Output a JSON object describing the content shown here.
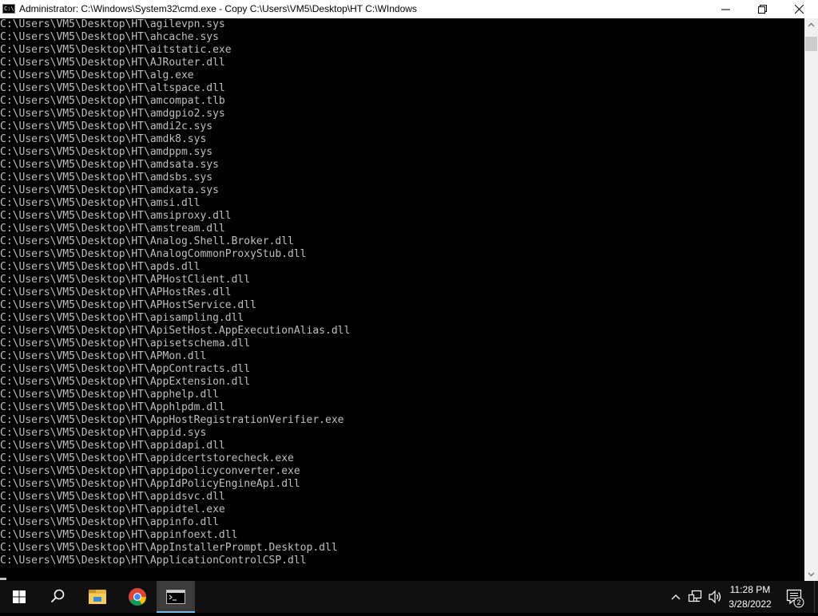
{
  "window": {
    "icon_text": "C:\\",
    "title": "Administrator: C:\\Windows\\System32\\cmd.exe - Copy  C:\\Users\\VM5\\Desktop\\HT C:\\WIndows"
  },
  "console": {
    "lines": [
      "C:\\Users\\VM5\\Desktop\\HT\\agilevpn.sys",
      "C:\\Users\\VM5\\Desktop\\HT\\ahcache.sys",
      "C:\\Users\\VM5\\Desktop\\HT\\aitstatic.exe",
      "C:\\Users\\VM5\\Desktop\\HT\\AJRouter.dll",
      "C:\\Users\\VM5\\Desktop\\HT\\alg.exe",
      "C:\\Users\\VM5\\Desktop\\HT\\altspace.dll",
      "C:\\Users\\VM5\\Desktop\\HT\\amcompat.tlb",
      "C:\\Users\\VM5\\Desktop\\HT\\amdgpio2.sys",
      "C:\\Users\\VM5\\Desktop\\HT\\amdi2c.sys",
      "C:\\Users\\VM5\\Desktop\\HT\\amdk8.sys",
      "C:\\Users\\VM5\\Desktop\\HT\\amdppm.sys",
      "C:\\Users\\VM5\\Desktop\\HT\\amdsata.sys",
      "C:\\Users\\VM5\\Desktop\\HT\\amdsbs.sys",
      "C:\\Users\\VM5\\Desktop\\HT\\amdxata.sys",
      "C:\\Users\\VM5\\Desktop\\HT\\amsi.dll",
      "C:\\Users\\VM5\\Desktop\\HT\\amsiproxy.dll",
      "C:\\Users\\VM5\\Desktop\\HT\\amstream.dll",
      "C:\\Users\\VM5\\Desktop\\HT\\Analog.Shell.Broker.dll",
      "C:\\Users\\VM5\\Desktop\\HT\\AnalogCommonProxyStub.dll",
      "C:\\Users\\VM5\\Desktop\\HT\\apds.dll",
      "C:\\Users\\VM5\\Desktop\\HT\\APHostClient.dll",
      "C:\\Users\\VM5\\Desktop\\HT\\APHostRes.dll",
      "C:\\Users\\VM5\\Desktop\\HT\\APHostService.dll",
      "C:\\Users\\VM5\\Desktop\\HT\\apisampling.dll",
      "C:\\Users\\VM5\\Desktop\\HT\\ApiSetHost.AppExecutionAlias.dll",
      "C:\\Users\\VM5\\Desktop\\HT\\apisetschema.dll",
      "C:\\Users\\VM5\\Desktop\\HT\\APMon.dll",
      "C:\\Users\\VM5\\Desktop\\HT\\AppContracts.dll",
      "C:\\Users\\VM5\\Desktop\\HT\\AppExtension.dll",
      "C:\\Users\\VM5\\Desktop\\HT\\apphelp.dll",
      "C:\\Users\\VM5\\Desktop\\HT\\Apphlpdm.dll",
      "C:\\Users\\VM5\\Desktop\\HT\\AppHostRegistrationVerifier.exe",
      "C:\\Users\\VM5\\Desktop\\HT\\appid.sys",
      "C:\\Users\\VM5\\Desktop\\HT\\appidapi.dll",
      "C:\\Users\\VM5\\Desktop\\HT\\appidcertstorecheck.exe",
      "C:\\Users\\VM5\\Desktop\\HT\\appidpolicyconverter.exe",
      "C:\\Users\\VM5\\Desktop\\HT\\AppIdPolicyEngineApi.dll",
      "C:\\Users\\VM5\\Desktop\\HT\\appidsvc.dll",
      "C:\\Users\\VM5\\Desktop\\HT\\appidtel.exe",
      "C:\\Users\\VM5\\Desktop\\HT\\appinfo.dll",
      "C:\\Users\\VM5\\Desktop\\HT\\appinfoext.dll",
      "C:\\Users\\VM5\\Desktop\\HT\\AppInstallerPrompt.Desktop.dll",
      "C:\\Users\\VM5\\Desktop\\HT\\ApplicationControlCSP.dll"
    ]
  },
  "taskbar": {
    "apps": [
      "windows-start-icon",
      "search-icon",
      "file-explorer-icon",
      "chrome-icon",
      "command-prompt-icon"
    ],
    "clock": {
      "time": "11:28 PM",
      "date": "3/28/2022"
    },
    "notifications": {
      "count": "2"
    }
  },
  "colors": {
    "console_bg": "#000000",
    "console_text": "#c0c0c0",
    "titlebar_bg": "#ffffff",
    "taskbar_bg": "#101010",
    "active_app_underline": "#76b9ed"
  }
}
